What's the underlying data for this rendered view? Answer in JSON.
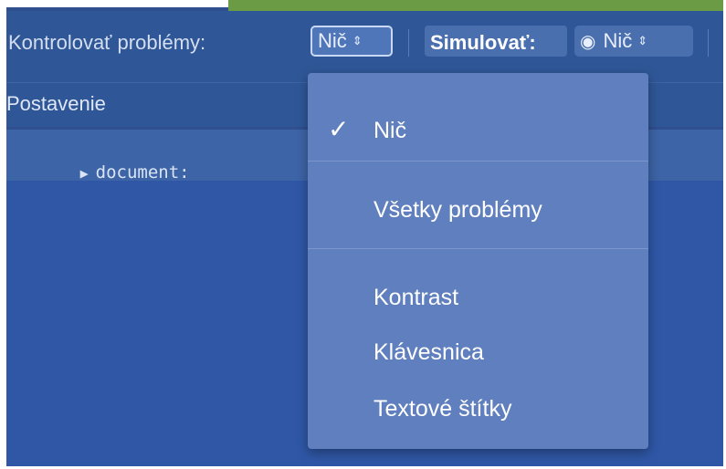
{
  "toolbar": {
    "check_issues_label": "Kontrolovať problémy:",
    "check_issues_value": "Nič",
    "simulate_label": "Simulovať:",
    "simulate_value": "Nič",
    "spinner_glyph": "⇕",
    "eye_glyph": "◉"
  },
  "tree": {
    "header": "Postavenie",
    "rows": [
      {
        "label": "document:"
      }
    ]
  },
  "dropdown": {
    "selected_index": 0,
    "check_glyph": "✓",
    "items": [
      {
        "label": "Nič",
        "checked": true
      },
      {
        "label": "Všetky problémy",
        "checked": false
      },
      {
        "label": "Kontrast",
        "checked": false
      },
      {
        "label": "Klávesnica",
        "checked": false
      },
      {
        "label": "Textové štítky",
        "checked": false
      }
    ]
  },
  "colors": {
    "panel_bg": "#2f5797",
    "dropdown_bg": "#5f7fbe",
    "accent_green": "#6b9b45"
  }
}
